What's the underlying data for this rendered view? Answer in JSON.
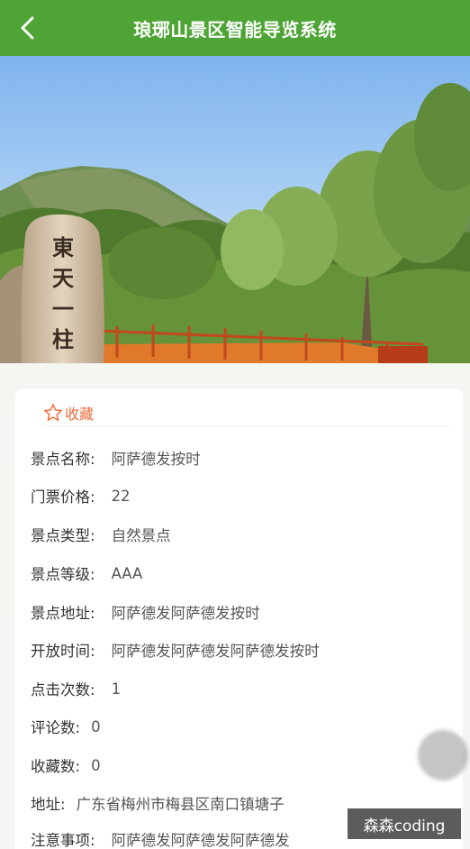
{
  "header": {
    "title": "琅琊山景区智能导览系统",
    "back_icon": "chevron-left-icon"
  },
  "hero": {
    "stone_text": [
      "東",
      "天",
      "一",
      "柱"
    ]
  },
  "favorite": {
    "label": "收藏",
    "icon": "star-outline-icon",
    "color": "#ef6b3a"
  },
  "details": [
    {
      "label": "景点名称:",
      "value": "阿萨德发按时"
    },
    {
      "label": "门票价格:",
      "value": "22"
    },
    {
      "label": "景点类型:",
      "value": "自然景点"
    },
    {
      "label": "景点等级:",
      "value": "AAA"
    },
    {
      "label": "景点地址:",
      "value": "阿萨德发阿萨德发按时"
    },
    {
      "label": "开放时间:",
      "value": "阿萨德发阿萨德发阿萨德发按时"
    },
    {
      "label": "点击次数:",
      "value": "1"
    },
    {
      "label": "评论数:",
      "value": "0"
    },
    {
      "label": "收藏数:",
      "value": "0"
    },
    {
      "label": "地址:",
      "value": "广东省梅州市梅县区南口镇塘子"
    },
    {
      "label": "注意事项:",
      "value": "阿萨德发阿萨德发阿萨德发"
    }
  ],
  "watermark": "森森coding",
  "colors": {
    "header_bg": "#4ea536",
    "accent": "#ef6b3a"
  }
}
